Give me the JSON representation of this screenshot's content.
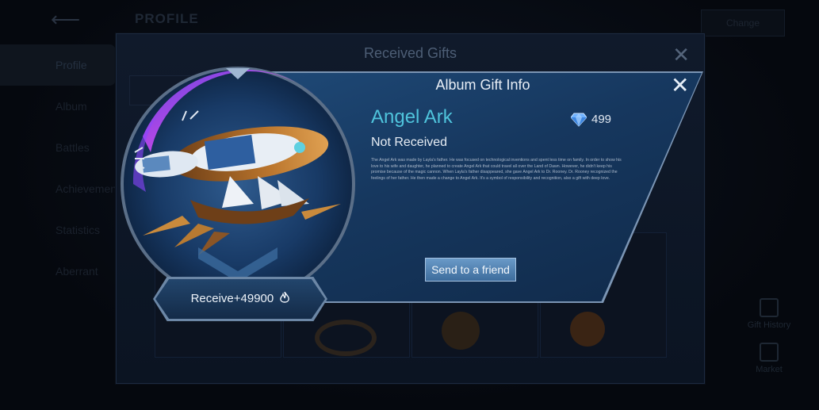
{
  "background": {
    "page_title": "PROFILE",
    "top_right_button": "Change",
    "sidebar_items": [
      "Profile",
      "Album",
      "Battles",
      "Achievements",
      "Statistics",
      "Aberrant"
    ],
    "right_buttons": [
      "Gift History",
      "Market"
    ]
  },
  "received_gifts": {
    "title": "Received Gifts",
    "close_icon": "close-icon"
  },
  "gift_info": {
    "title": "Album Gift Info",
    "close_icon": "close-icon",
    "item_name": "Angel Ark",
    "price_icon": "diamond-icon",
    "price": "499",
    "status": "Not Received",
    "description": "The Angel Ark was made by Layla's father. He was focused on technological inventions and spent less time on family. In order to show his love to his wife and daughter, he planned to create Angel Ark that could travel all over the Land of Dawn. However, he didn't keep his promise because of the magic cannon. When Layla's father disappeared, she gave Angel Ark to Dr. Rooney. Dr. Rooney recognized the feelings of her father. He then made a change to Angel Ark. It's a symbol of responsibility and recognition, also a gift with deep love.",
    "send_button": "Send to a friend",
    "receive_label": "Receive+49900",
    "receive_icon": "flame-icon"
  },
  "colors": {
    "accent_cyan": "#4fc4dc",
    "card_blue": "#1f4a78",
    "button_blue": "#4d7fb0"
  }
}
